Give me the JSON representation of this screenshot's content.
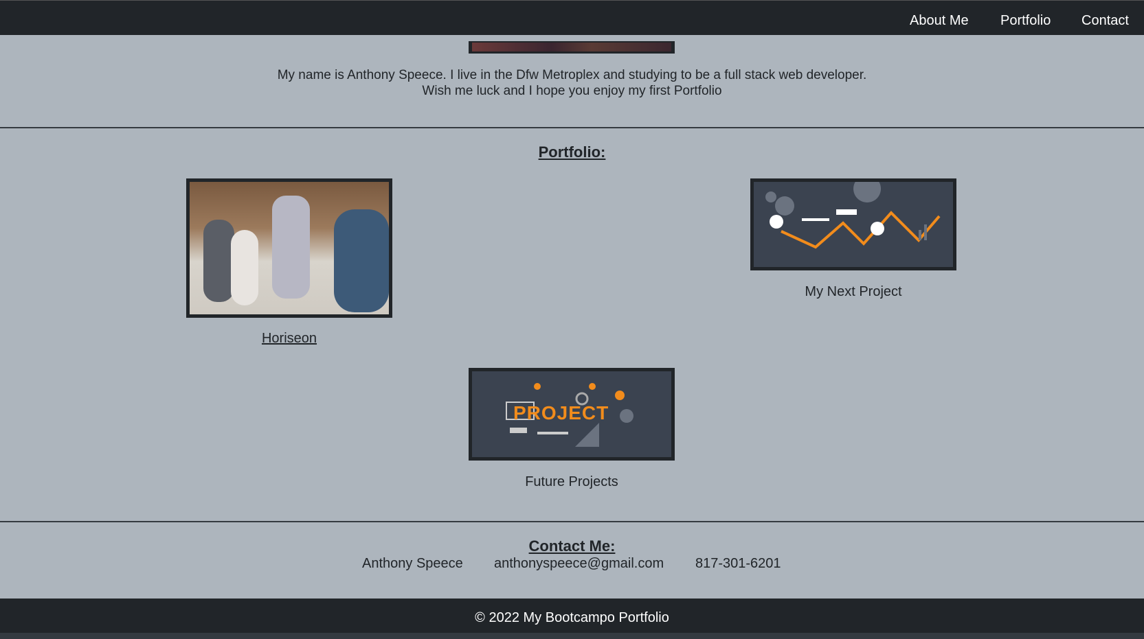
{
  "nav": {
    "items": [
      "About Me",
      "Portfolio",
      "Contact"
    ]
  },
  "about": {
    "line1": "My name is Anthony Speece. I live in the Dfw Metroplex and studying to be a full stack web developer.",
    "line2": "Wish me luck and I hope you enjoy my first Portfolio"
  },
  "portfolio": {
    "heading": "Portfolio:",
    "projects": [
      {
        "label": "Horiseon"
      },
      {
        "label": "My Next Project"
      },
      {
        "label": "Future Projects",
        "image_text": "PROJECT"
      }
    ]
  },
  "contact": {
    "heading": "Contact Me:",
    "name": "Anthony Speece",
    "email": "anthonyspeece@gmail.com",
    "phone": "817-301-6201"
  },
  "footer": {
    "text": "© 2022 My Bootcampo Portfolio"
  }
}
